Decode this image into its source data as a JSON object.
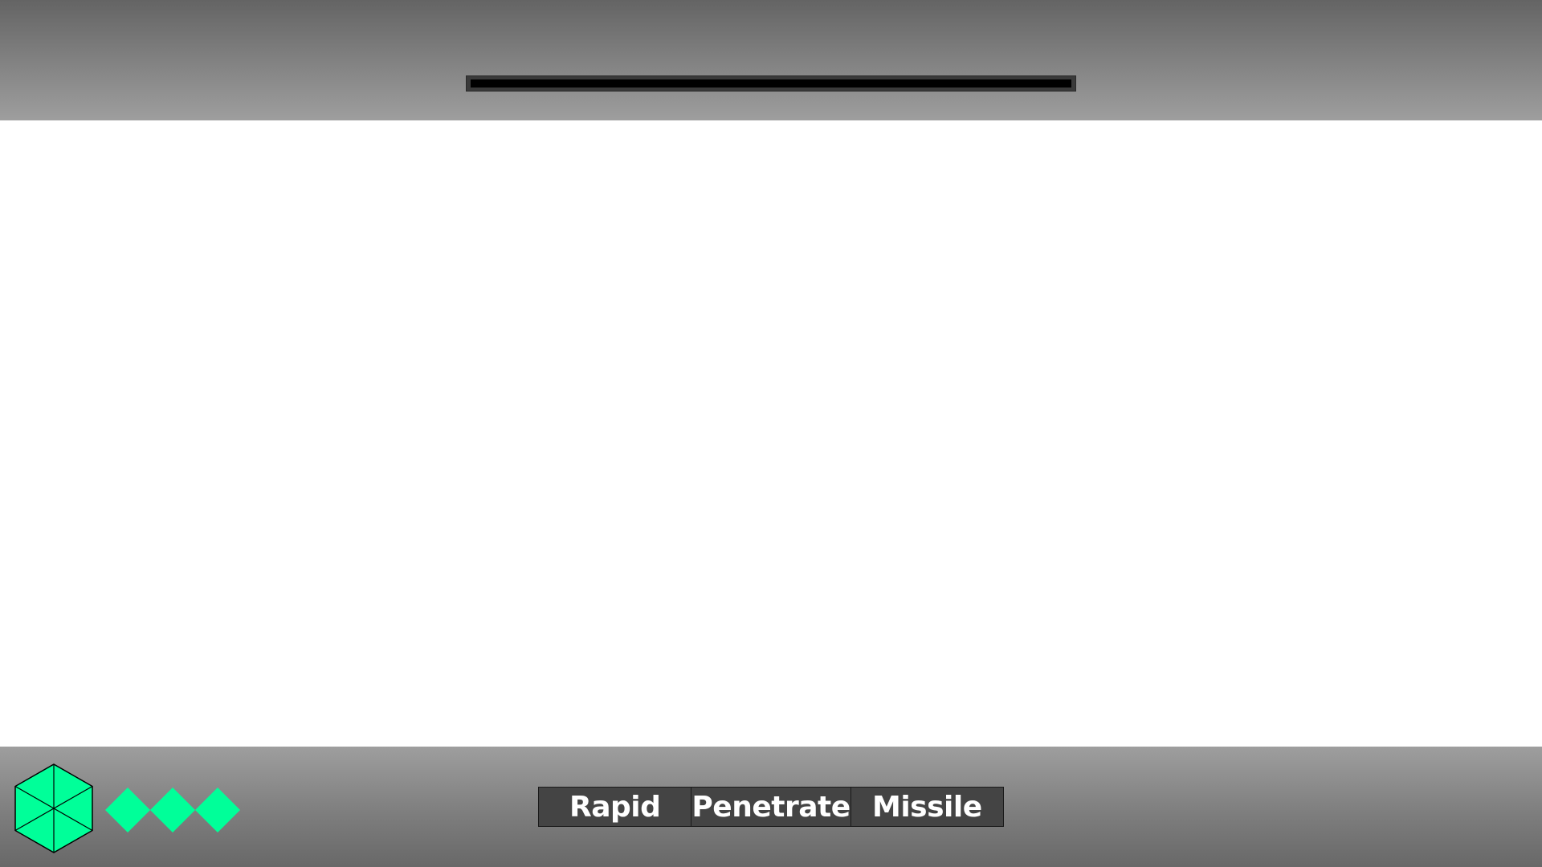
{
  "hud": {
    "health_bar": {
      "fill_fraction": 0.0,
      "track_color": "#000000",
      "frame_color": "#3a3a3a"
    },
    "player_emblem": {
      "icon": "hexagon-icon",
      "fill_color": "#00ff99",
      "stroke_color": "#000000"
    },
    "lives": {
      "count": 3,
      "icon": "diamond-icon",
      "fill_color": "#00ff99"
    },
    "weapons": [
      {
        "label": "Rapid"
      },
      {
        "label": "Penetrate"
      },
      {
        "label": "Missile"
      }
    ]
  },
  "colors": {
    "accent": "#00ff99",
    "hud_gray_dark": "#646464",
    "hud_gray_light": "#9e9e9e",
    "play_field": "#ffffff",
    "weapon_bg": "#444444",
    "weapon_text": "#ffffff"
  }
}
